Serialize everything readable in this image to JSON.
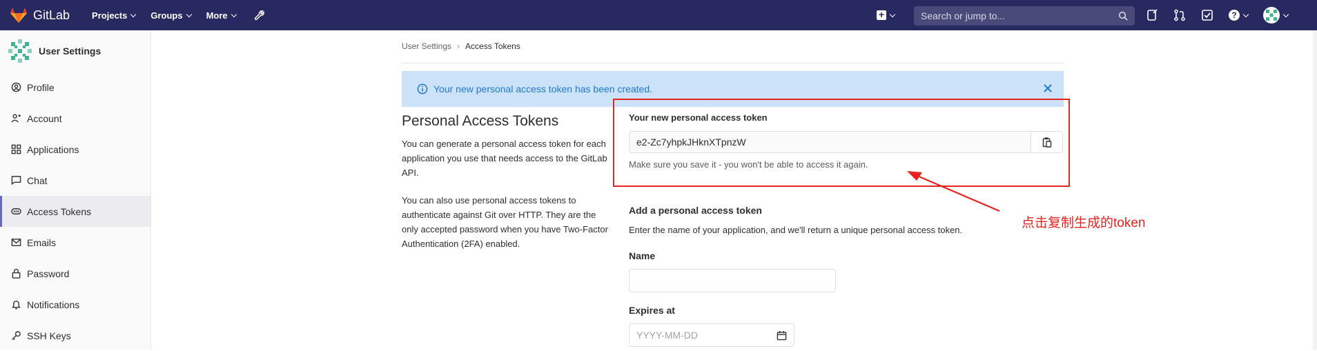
{
  "navbar": {
    "brand": "GitLab",
    "menu": [
      {
        "label": "Projects"
      },
      {
        "label": "Groups"
      },
      {
        "label": "More"
      }
    ],
    "search_placeholder": "Search or jump to...",
    "brand_color": "#292961"
  },
  "sidebar": {
    "title": "User Settings",
    "items": [
      {
        "label": "Profile",
        "icon": "profile-icon"
      },
      {
        "label": "Account",
        "icon": "account-icon"
      },
      {
        "label": "Applications",
        "icon": "applications-icon"
      },
      {
        "label": "Chat",
        "icon": "chat-icon"
      },
      {
        "label": "Access Tokens",
        "icon": "token-icon",
        "active": true
      },
      {
        "label": "Emails",
        "icon": "mail-icon"
      },
      {
        "label": "Password",
        "icon": "lock-icon"
      },
      {
        "label": "Notifications",
        "icon": "bell-icon"
      },
      {
        "label": "SSH Keys",
        "icon": "key-icon"
      }
    ]
  },
  "breadcrumb": {
    "parent": "User Settings",
    "current": "Access Tokens"
  },
  "alert": {
    "message": "Your new personal access token has been created."
  },
  "page": {
    "title": "Personal Access Tokens",
    "description_1": "You can generate a personal access token for each application you use that needs access to the GitLab API.",
    "description_2": "You can also use personal access tokens to authenticate against Git over HTTP. They are the only accepted password when you have Two-Factor Authentication (2FA) enabled."
  },
  "token": {
    "label": "Your new personal access token",
    "value": "e2-Zc7yhpkJHknXTpnzW",
    "hint": "Make sure you save it - you won't be able to access it again."
  },
  "form": {
    "title": "Add a personal access token",
    "description": "Enter the name of your application, and we'll return a unique personal access token.",
    "name_label": "Name",
    "name_value": "",
    "expires_label": "Expires at",
    "expires_placeholder": "YYYY-MM-DD"
  },
  "annotation": {
    "text": "点击复制生成的token",
    "color": "#e8221e"
  }
}
